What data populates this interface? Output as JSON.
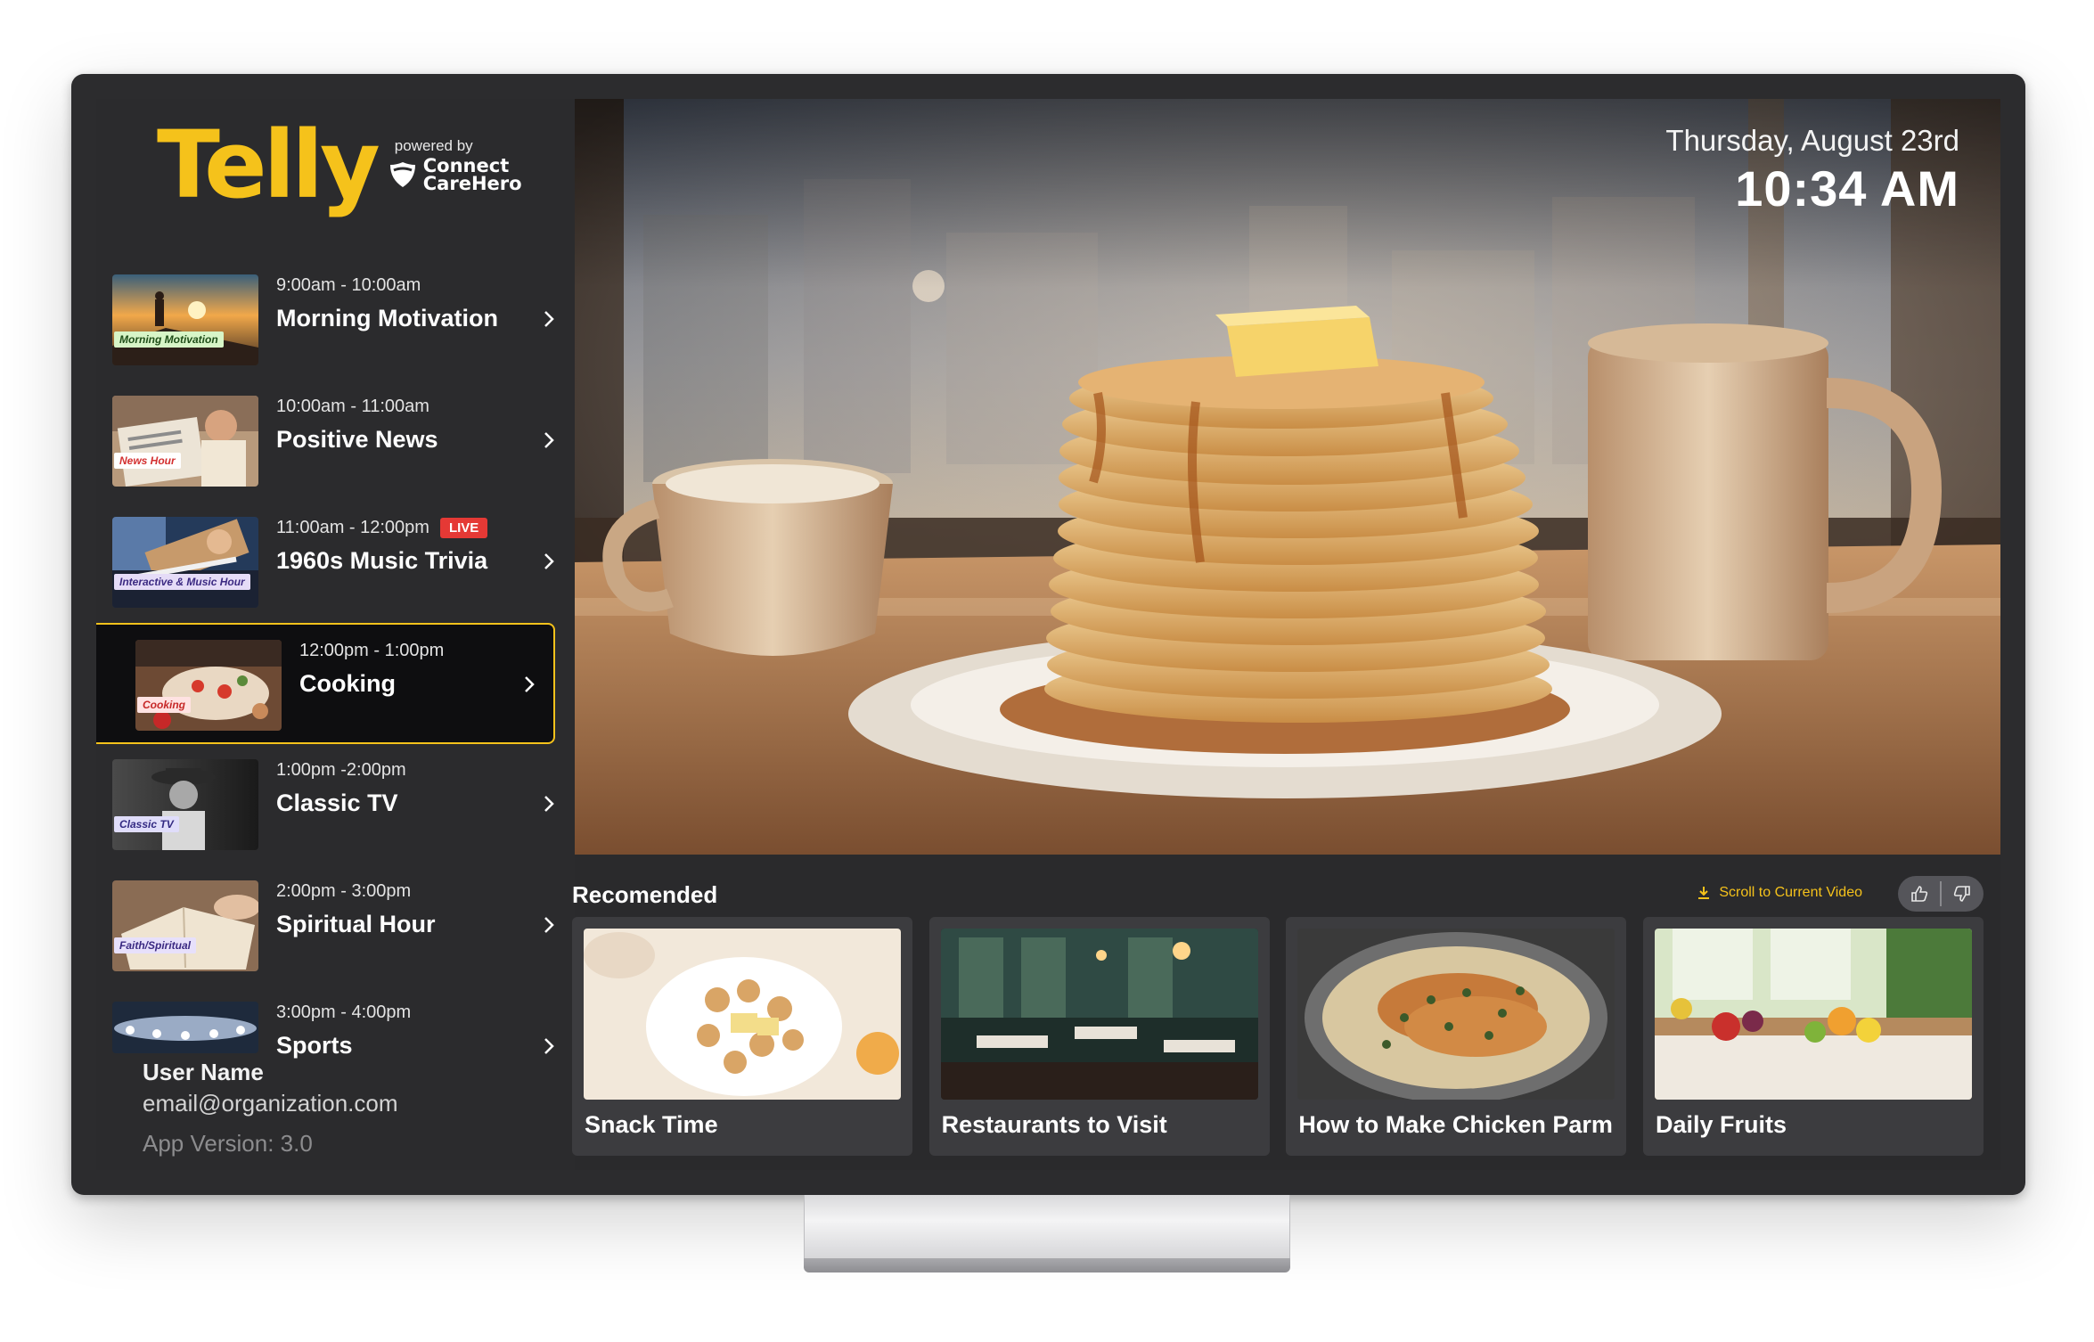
{
  "brand": {
    "title": "Telly",
    "powered_by": "powered by",
    "partner_line1": "Connect",
    "partner_line2": "CareHero"
  },
  "datetime": {
    "date": "Thursday, August 23rd",
    "time": "10:34 AM"
  },
  "schedule": [
    {
      "time": "9:00am - 10:00am",
      "title": "Morning Motivation",
      "tag": "Morning Motivation",
      "live": false,
      "active": false
    },
    {
      "time": "10:00am - 11:00am",
      "title": "Positive News",
      "tag": "News Hour",
      "live": false,
      "active": false
    },
    {
      "time": "11:00am - 12:00pm",
      "title": "1960s Music Trivia",
      "tag": "Interactive & Music Hour",
      "live": true,
      "active": false
    },
    {
      "time": "12:00pm - 1:00pm",
      "title": "Cooking",
      "tag": "Cooking",
      "live": false,
      "active": true
    },
    {
      "time": "1:00pm -2:00pm",
      "title": "Classic TV",
      "tag": "Classic TV",
      "live": false,
      "active": false
    },
    {
      "time": "2:00pm - 3:00pm",
      "title": "Spiritual Hour",
      "tag": "Faith/Spiritual",
      "live": false,
      "active": false
    },
    {
      "time": "3:00pm - 4:00pm",
      "title": "Sports",
      "tag": "",
      "live": false,
      "active": false
    }
  ],
  "live_label": "LIVE",
  "user": {
    "name": "User Name",
    "email": "email@organization.com",
    "app_version": "App Version: 3.0"
  },
  "recommended": {
    "title": "Recomended",
    "scroll_link": "Scroll to Current Video",
    "cards": [
      {
        "title": "Snack Time"
      },
      {
        "title": "Restaurants to Visit"
      },
      {
        "title": "How to Make Chicken Parm"
      },
      {
        "title": "Daily Fruits"
      }
    ]
  },
  "colors": {
    "accent": "#f5c21b",
    "live": "#e53935",
    "panel": "#2b2b2d",
    "card": "#3c3c3f"
  },
  "icons": {
    "chevron": "chevron-right-icon",
    "download": "download-icon",
    "thumbs_up": "thumbs-up-icon",
    "thumbs_down": "thumbs-down-icon",
    "shield": "shield-icon"
  }
}
